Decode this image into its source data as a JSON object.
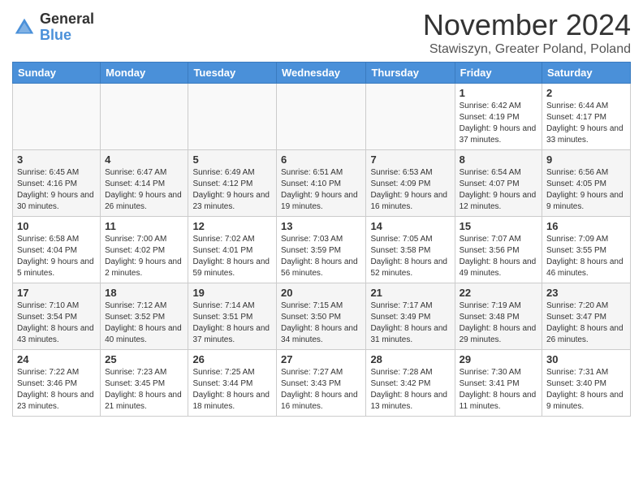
{
  "logo": {
    "general": "General",
    "blue": "Blue"
  },
  "title": "November 2024",
  "subtitle": "Stawiszyn, Greater Poland, Poland",
  "days_of_week": [
    "Sunday",
    "Monday",
    "Tuesday",
    "Wednesday",
    "Thursday",
    "Friday",
    "Saturday"
  ],
  "weeks": [
    [
      {
        "day": "",
        "info": ""
      },
      {
        "day": "",
        "info": ""
      },
      {
        "day": "",
        "info": ""
      },
      {
        "day": "",
        "info": ""
      },
      {
        "day": "",
        "info": ""
      },
      {
        "day": "1",
        "info": "Sunrise: 6:42 AM\nSunset: 4:19 PM\nDaylight: 9 hours\nand 37 minutes."
      },
      {
        "day": "2",
        "info": "Sunrise: 6:44 AM\nSunset: 4:17 PM\nDaylight: 9 hours\nand 33 minutes."
      }
    ],
    [
      {
        "day": "3",
        "info": "Sunrise: 6:45 AM\nSunset: 4:16 PM\nDaylight: 9 hours\nand 30 minutes."
      },
      {
        "day": "4",
        "info": "Sunrise: 6:47 AM\nSunset: 4:14 PM\nDaylight: 9 hours\nand 26 minutes."
      },
      {
        "day": "5",
        "info": "Sunrise: 6:49 AM\nSunset: 4:12 PM\nDaylight: 9 hours\nand 23 minutes."
      },
      {
        "day": "6",
        "info": "Sunrise: 6:51 AM\nSunset: 4:10 PM\nDaylight: 9 hours\nand 19 minutes."
      },
      {
        "day": "7",
        "info": "Sunrise: 6:53 AM\nSunset: 4:09 PM\nDaylight: 9 hours\nand 16 minutes."
      },
      {
        "day": "8",
        "info": "Sunrise: 6:54 AM\nSunset: 4:07 PM\nDaylight: 9 hours\nand 12 minutes."
      },
      {
        "day": "9",
        "info": "Sunrise: 6:56 AM\nSunset: 4:05 PM\nDaylight: 9 hours\nand 9 minutes."
      }
    ],
    [
      {
        "day": "10",
        "info": "Sunrise: 6:58 AM\nSunset: 4:04 PM\nDaylight: 9 hours\nand 5 minutes."
      },
      {
        "day": "11",
        "info": "Sunrise: 7:00 AM\nSunset: 4:02 PM\nDaylight: 9 hours\nand 2 minutes."
      },
      {
        "day": "12",
        "info": "Sunrise: 7:02 AM\nSunset: 4:01 PM\nDaylight: 8 hours\nand 59 minutes."
      },
      {
        "day": "13",
        "info": "Sunrise: 7:03 AM\nSunset: 3:59 PM\nDaylight: 8 hours\nand 56 minutes."
      },
      {
        "day": "14",
        "info": "Sunrise: 7:05 AM\nSunset: 3:58 PM\nDaylight: 8 hours\nand 52 minutes."
      },
      {
        "day": "15",
        "info": "Sunrise: 7:07 AM\nSunset: 3:56 PM\nDaylight: 8 hours\nand 49 minutes."
      },
      {
        "day": "16",
        "info": "Sunrise: 7:09 AM\nSunset: 3:55 PM\nDaylight: 8 hours\nand 46 minutes."
      }
    ],
    [
      {
        "day": "17",
        "info": "Sunrise: 7:10 AM\nSunset: 3:54 PM\nDaylight: 8 hours\nand 43 minutes."
      },
      {
        "day": "18",
        "info": "Sunrise: 7:12 AM\nSunset: 3:52 PM\nDaylight: 8 hours\nand 40 minutes."
      },
      {
        "day": "19",
        "info": "Sunrise: 7:14 AM\nSunset: 3:51 PM\nDaylight: 8 hours\nand 37 minutes."
      },
      {
        "day": "20",
        "info": "Sunrise: 7:15 AM\nSunset: 3:50 PM\nDaylight: 8 hours\nand 34 minutes."
      },
      {
        "day": "21",
        "info": "Sunrise: 7:17 AM\nSunset: 3:49 PM\nDaylight: 8 hours\nand 31 minutes."
      },
      {
        "day": "22",
        "info": "Sunrise: 7:19 AM\nSunset: 3:48 PM\nDaylight: 8 hours\nand 29 minutes."
      },
      {
        "day": "23",
        "info": "Sunrise: 7:20 AM\nSunset: 3:47 PM\nDaylight: 8 hours\nand 26 minutes."
      }
    ],
    [
      {
        "day": "24",
        "info": "Sunrise: 7:22 AM\nSunset: 3:46 PM\nDaylight: 8 hours\nand 23 minutes."
      },
      {
        "day": "25",
        "info": "Sunrise: 7:23 AM\nSunset: 3:45 PM\nDaylight: 8 hours\nand 21 minutes."
      },
      {
        "day": "26",
        "info": "Sunrise: 7:25 AM\nSunset: 3:44 PM\nDaylight: 8 hours\nand 18 minutes."
      },
      {
        "day": "27",
        "info": "Sunrise: 7:27 AM\nSunset: 3:43 PM\nDaylight: 8 hours\nand 16 minutes."
      },
      {
        "day": "28",
        "info": "Sunrise: 7:28 AM\nSunset: 3:42 PM\nDaylight: 8 hours\nand 13 minutes."
      },
      {
        "day": "29",
        "info": "Sunrise: 7:30 AM\nSunset: 3:41 PM\nDaylight: 8 hours\nand 11 minutes."
      },
      {
        "day": "30",
        "info": "Sunrise: 7:31 AM\nSunset: 3:40 PM\nDaylight: 8 hours\nand 9 minutes."
      }
    ]
  ]
}
